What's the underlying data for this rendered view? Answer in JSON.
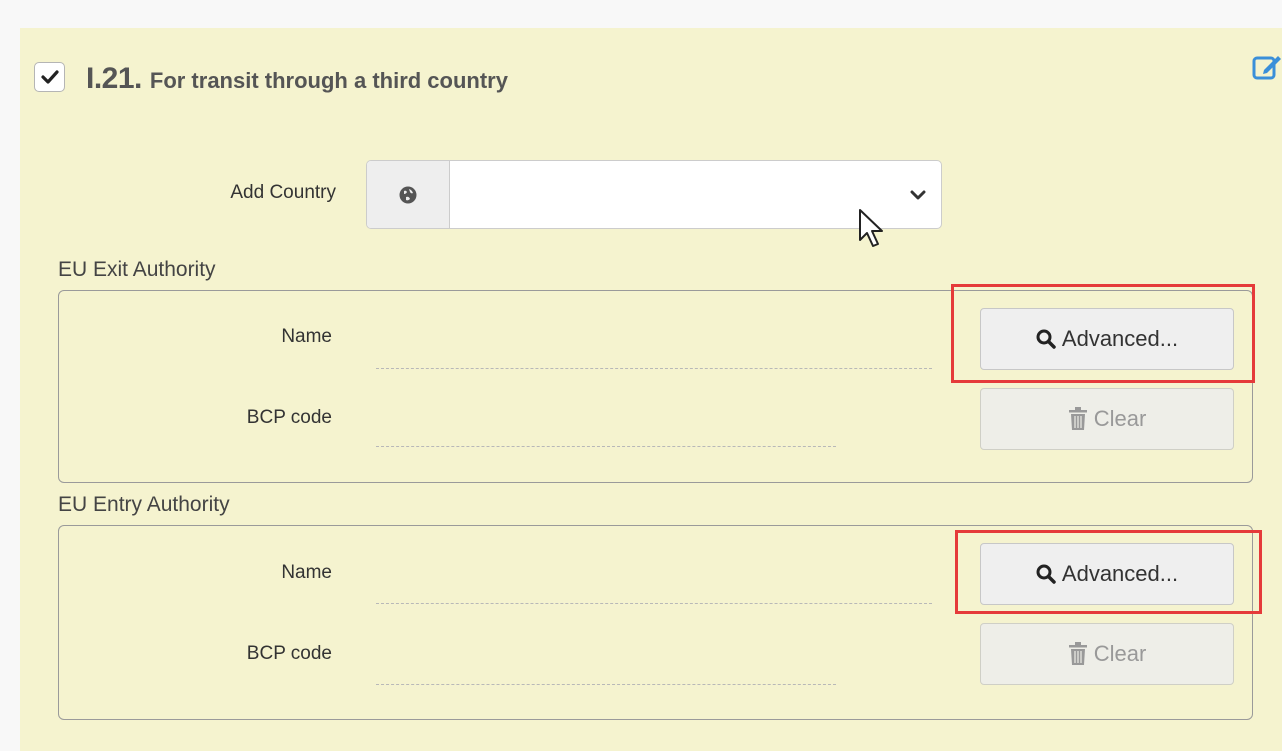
{
  "section": {
    "number": "I.21.",
    "title": "For transit through a third country",
    "checked": true
  },
  "add_country": {
    "label": "Add Country",
    "value": "",
    "icon": "globe-icon"
  },
  "exit_authority": {
    "title": "EU Exit Authority",
    "name_label": "Name",
    "name_value": "",
    "bcp_label": "BCP code",
    "bcp_value": "",
    "advanced_label": "Advanced...",
    "clear_label": "Clear"
  },
  "entry_authority": {
    "title": "EU Entry Authority",
    "name_label": "Name",
    "name_value": "",
    "bcp_label": "BCP code",
    "bcp_value": "",
    "advanced_label": "Advanced...",
    "clear_label": "Clear"
  },
  "colors": {
    "panel_bg": "#f5f3cf",
    "highlight": "#e53a3a",
    "edit_icon": "#3a8fd9"
  }
}
